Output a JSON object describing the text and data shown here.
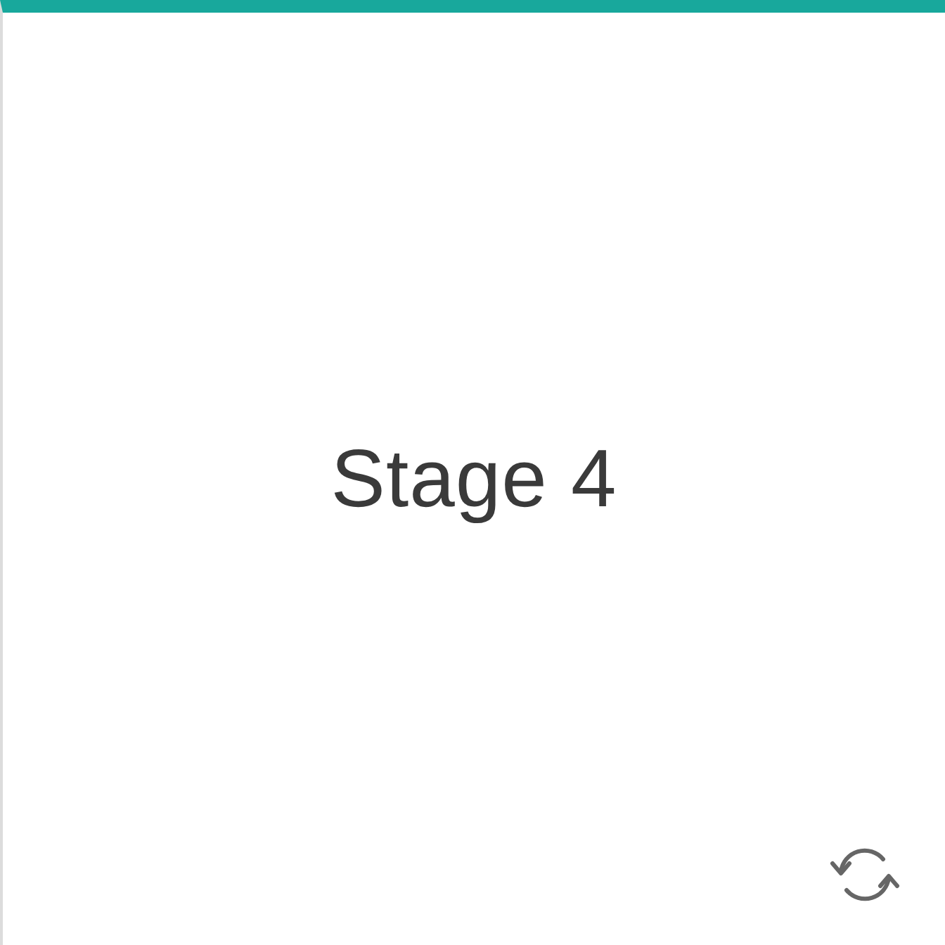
{
  "card": {
    "title": "Stage 4"
  }
}
